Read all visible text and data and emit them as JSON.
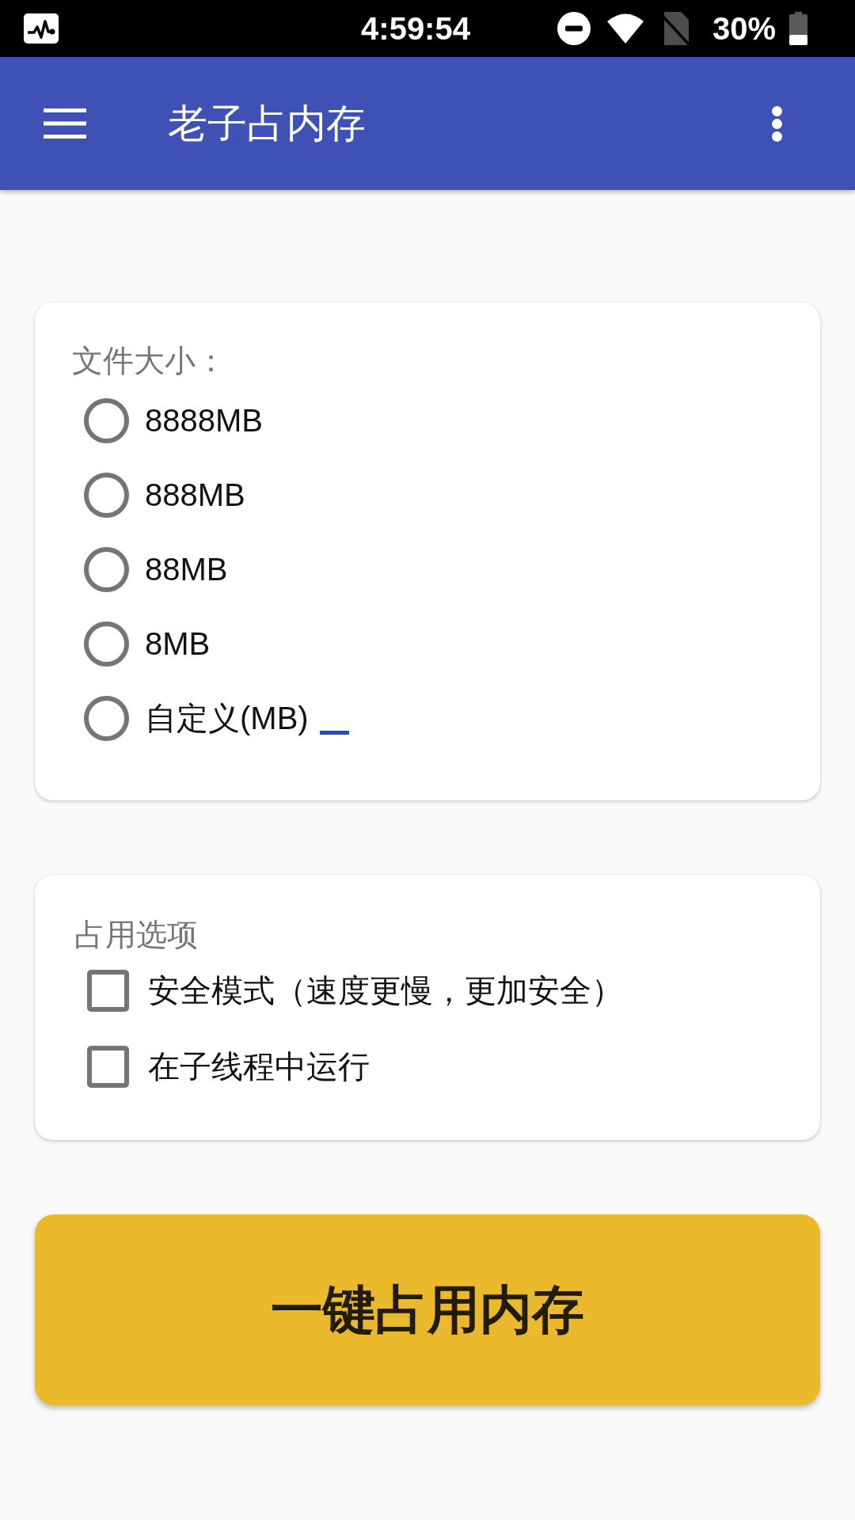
{
  "status_bar": {
    "time": "4:59:54",
    "battery": "30%"
  },
  "app_bar": {
    "title": "老子占内存"
  },
  "size_card": {
    "label": "文件大小：",
    "options": [
      {
        "kind": "preset",
        "label": "8888MB",
        "selected": false
      },
      {
        "kind": "preset",
        "label": "888MB",
        "selected": false
      },
      {
        "kind": "preset",
        "label": "88MB",
        "selected": false
      },
      {
        "kind": "preset",
        "label": "8MB",
        "selected": false
      },
      {
        "kind": "custom",
        "label": "自定义(MB)",
        "selected": false
      }
    ]
  },
  "options_card": {
    "label": "占用选项",
    "options": [
      {
        "label": "安全模式（速度更慢，更加安全）",
        "checked": false
      },
      {
        "label": "在子线程中运行",
        "checked": false
      }
    ]
  },
  "action_button": {
    "label": "一键占用内存"
  }
}
